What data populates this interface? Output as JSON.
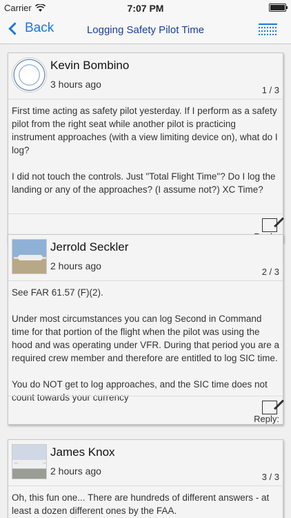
{
  "status_bar": {
    "carrier": "Carrier",
    "time": "7:07 PM"
  },
  "nav": {
    "back_label": "Back",
    "title": "Logging Safety Pilot Time"
  },
  "posts": [
    {
      "author": "Kevin Bombino",
      "time": "3 hours ago",
      "counter": "1 / 3",
      "paragraphs": [
        "First time acting as safety pilot yesterday.  If I perform as a safety pilot from the right seat while another pilot is practicing instrument approaches (with a view limiting device on), what do I log?",
        "I did not touch the controls.  Just \"Total Flight Time\"?  Do I log the landing or any of the approaches?  (I assume not?)  XC Time?"
      ],
      "reply_label": "Reply:"
    },
    {
      "author": "Jerrold Seckler",
      "time": "2 hours ago",
      "counter": "2 / 3",
      "paragraphs": [
        "See FAR 61.57 (F)(2).",
        "Under most circumstances you can log Second in Command time for that portion of the flight when the pilot was using the hood and was operating under VFR.  During that period you are a required crew member and therefore are entitled to log SIC time.",
        "You do NOT get to log approaches, and the SIC time does not count towards your currency"
      ],
      "reply_label": "Reply:"
    },
    {
      "author": "James Knox",
      "time": "2 hours ago",
      "counter": "3 / 3",
      "paragraphs": [
        "Oh, this fun one...   There are hundreds of different answers - at least a dozen different ones by the FAA."
      ]
    }
  ]
}
